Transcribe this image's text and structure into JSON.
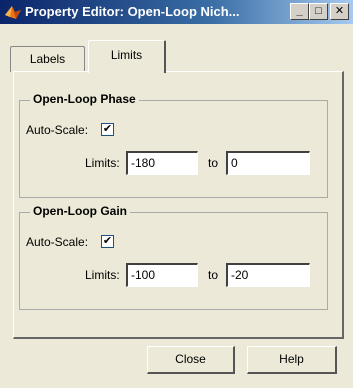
{
  "window": {
    "title": "Property Editor: Open-Loop Nich...",
    "minimize_label": "_",
    "maximize_label": "□",
    "close_label": "✕"
  },
  "tabs": [
    {
      "label": "Labels",
      "selected": false
    },
    {
      "label": "Limits",
      "selected": true
    }
  ],
  "groups": {
    "phase": {
      "title": "Open-Loop Phase",
      "autoscale_label": "Auto-Scale:",
      "autoscale_checked": true,
      "limits_label": "Limits:",
      "min": "-180",
      "to_label": "to",
      "max": "0"
    },
    "gain": {
      "title": "Open-Loop Gain",
      "autoscale_label": "Auto-Scale:",
      "autoscale_checked": true,
      "limits_label": "Limits:",
      "min": "-100",
      "to_label": "to",
      "max": "-20"
    }
  },
  "buttons": {
    "close": "Close",
    "help": "Help"
  },
  "check_glyph": "✔"
}
